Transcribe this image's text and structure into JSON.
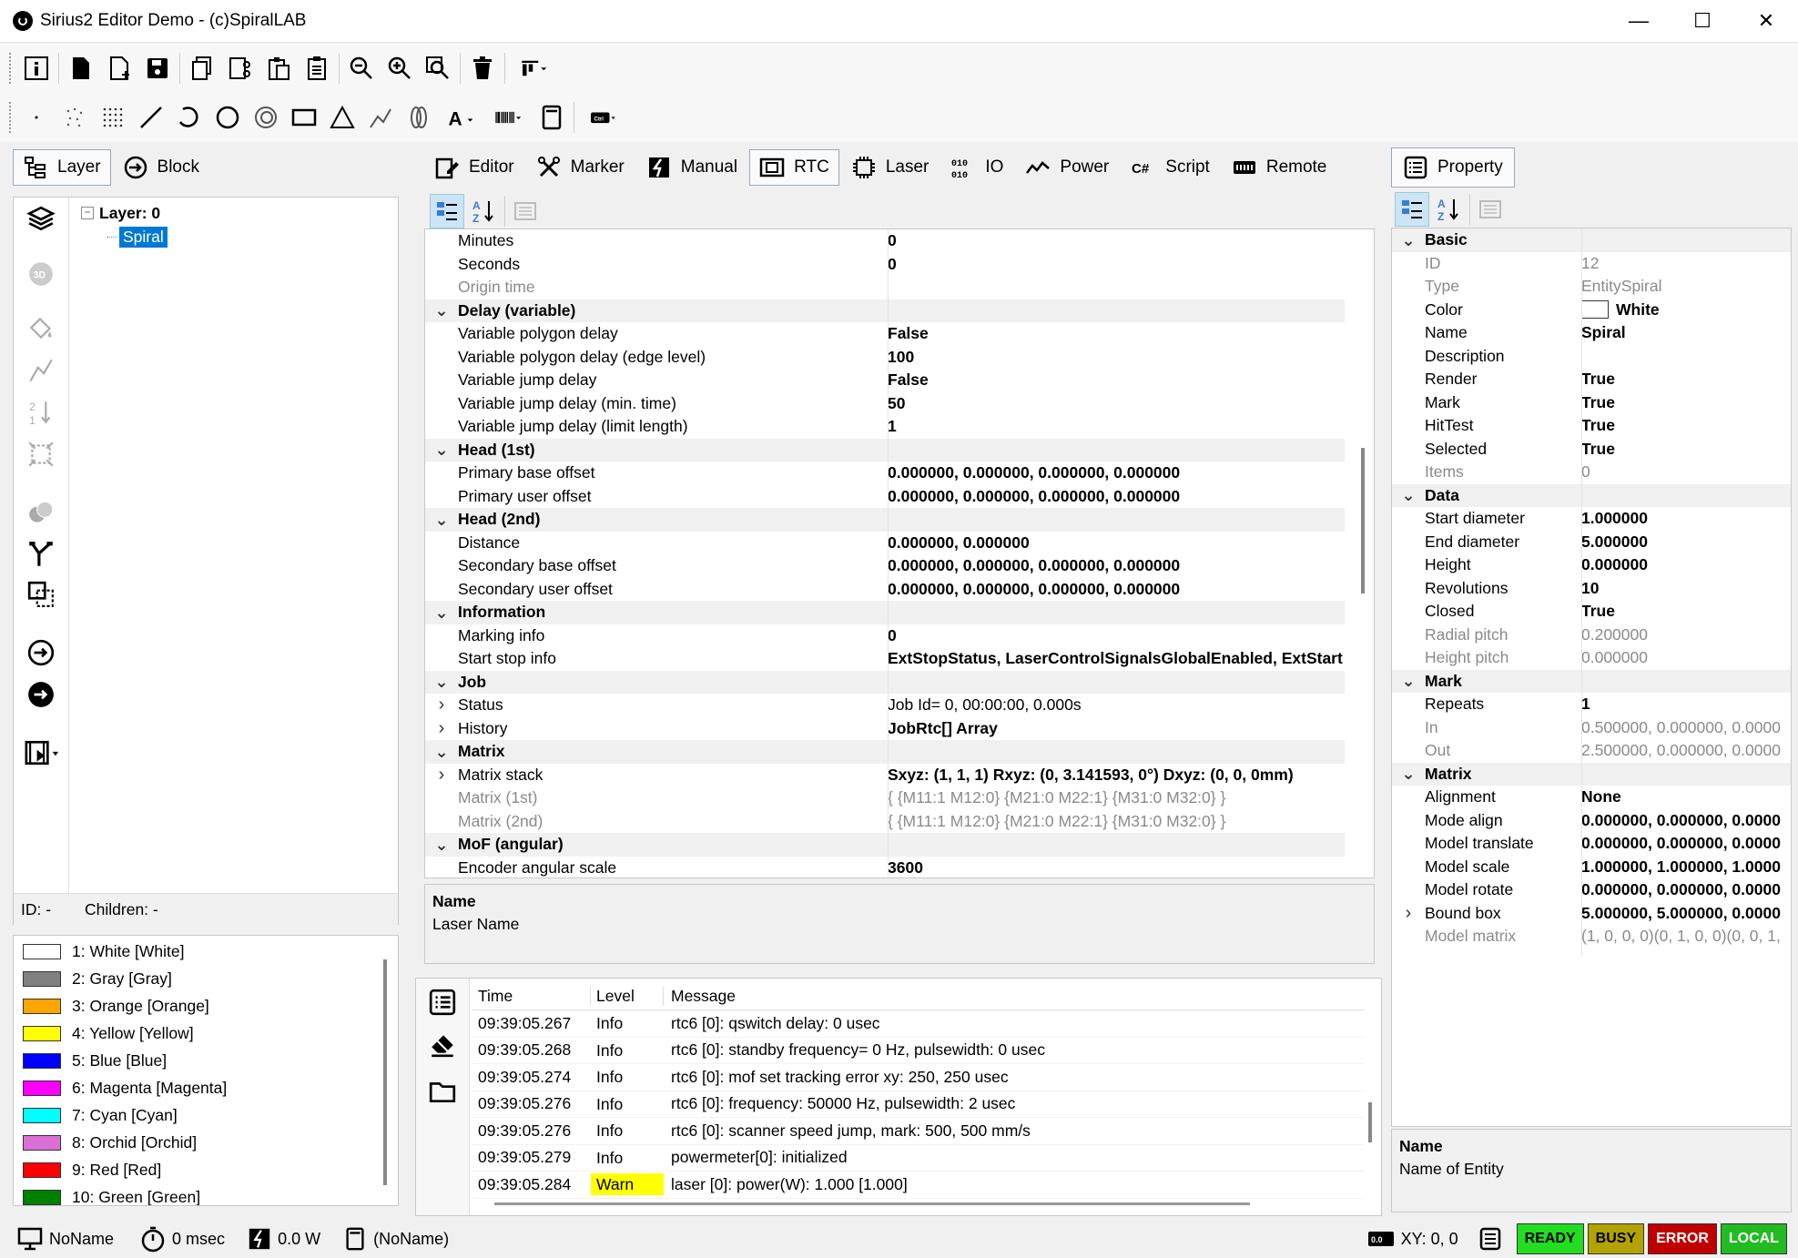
{
  "window": {
    "title": "Sirius2 Editor Demo - (c)SpiralLAB",
    "min": "—",
    "max": "☐",
    "close": "✕"
  },
  "left": {
    "tabs": {
      "layer": "Layer",
      "block": "Block"
    },
    "tree": {
      "layer": "Layer: 0",
      "child": "Spiral"
    },
    "status": {
      "id": "ID: -",
      "children": "Children: -"
    },
    "pens": [
      {
        "label": "1: White [White]",
        "color": "#ffffff"
      },
      {
        "label": "2: Gray [Gray]",
        "color": "#808080"
      },
      {
        "label": "3: Orange [Orange]",
        "color": "#ffa500"
      },
      {
        "label": "4: Yellow [Yellow]",
        "color": "#ffff00"
      },
      {
        "label": "5: Blue [Blue]",
        "color": "#0000ff"
      },
      {
        "label": "6: Magenta [Magenta]",
        "color": "#ff00ff"
      },
      {
        "label": "7: Cyan [Cyan]",
        "color": "#00ffff"
      },
      {
        "label": "8: Orchid [Orchid]",
        "color": "#da70d6"
      },
      {
        "label": "9: Red [Red]",
        "color": "#ff0000"
      },
      {
        "label": "10: Green [Green]",
        "color": "#008000"
      }
    ]
  },
  "center": {
    "tabs": [
      "Editor",
      "Marker",
      "Manual",
      "RTC",
      "Laser",
      "IO",
      "Power",
      "Script",
      "Remote"
    ],
    "grid": [
      {
        "t": "row",
        "name": "Minutes",
        "val": "0"
      },
      {
        "t": "row",
        "name": "Seconds",
        "val": "0"
      },
      {
        "t": "dis",
        "name": "Origin time",
        "val": ""
      },
      {
        "t": "cat",
        "name": "Delay (variable)"
      },
      {
        "t": "row",
        "name": "Variable polygon delay",
        "val": "False"
      },
      {
        "t": "row",
        "name": "Variable polygon delay (edge level)",
        "val": "100"
      },
      {
        "t": "row",
        "name": "Variable jump delay",
        "val": "False"
      },
      {
        "t": "row",
        "name": "Variable jump delay (min. time)",
        "val": "50"
      },
      {
        "t": "row",
        "name": "Variable jump delay (limit length)",
        "val": "1"
      },
      {
        "t": "cat",
        "name": "Head (1st)"
      },
      {
        "t": "row",
        "name": "Primary base offset",
        "val": "0.000000, 0.000000, 0.000000, 0.000000"
      },
      {
        "t": "row",
        "name": "Primary user offset",
        "val": "0.000000, 0.000000, 0.000000, 0.000000"
      },
      {
        "t": "cat",
        "name": "Head (2nd)"
      },
      {
        "t": "row",
        "name": "Distance",
        "val": "0.000000, 0.000000"
      },
      {
        "t": "row",
        "name": "Secondary base offset",
        "val": "0.000000, 0.000000, 0.000000, 0.000000"
      },
      {
        "t": "row",
        "name": "Secondary user offset",
        "val": "0.000000, 0.000000, 0.000000, 0.000000"
      },
      {
        "t": "cat",
        "name": "Information"
      },
      {
        "t": "row",
        "name": "Marking info",
        "val": "0"
      },
      {
        "t": "row",
        "name": "Start stop info",
        "val": "ExtStopStatus, LaserControlSignalsGlobalEnabled, ExtStart"
      },
      {
        "t": "cat",
        "name": "Job"
      },
      {
        "t": "sub",
        "name": "Status",
        "val": "Job Id= 0, 00:00:00, 0.000s",
        "norm": true
      },
      {
        "t": "sub",
        "name": "History",
        "val": "JobRtc[] Array"
      },
      {
        "t": "cat",
        "name": "Matrix"
      },
      {
        "t": "sub",
        "name": "Matrix stack",
        "val": "Sxyz: (1, 1, 1) Rxyz: (0, 3.141593, 0°) Dxyz: (0, 0, 0mm)"
      },
      {
        "t": "dis",
        "name": "Matrix (1st)",
        "val": "{ {M11:1 M12:0} {M21:0 M22:1} {M31:0 M32:0} }"
      },
      {
        "t": "dis",
        "name": "Matrix (2nd)",
        "val": "{ {M11:1 M12:0} {M21:0 M22:1} {M31:0 M32:0} }"
      },
      {
        "t": "cat",
        "name": "MoF (angular)"
      },
      {
        "t": "row",
        "name": "Encoder angular scale",
        "val": "3600"
      }
    ],
    "desc": {
      "title": "Name",
      "text": "Laser Name"
    },
    "log": {
      "headers": {
        "time": "Time",
        "level": "Level",
        "message": "Message"
      },
      "rows": [
        {
          "time": "09:39:05.267",
          "level": "Info",
          "msg": "rtc6 [0]: qswitch delay: 0 usec"
        },
        {
          "time": "09:39:05.268",
          "level": "Info",
          "msg": "rtc6 [0]: standby frequency= 0 Hz, pulsewidth: 0 usec"
        },
        {
          "time": "09:39:05.274",
          "level": "Info",
          "msg": "rtc6 [0]: mof set tracking error xy: 250, 250 usec"
        },
        {
          "time": "09:39:05.276",
          "level": "Info",
          "msg": "rtc6 [0]: frequency: 50000 Hz, pulsewidth: 2 usec"
        },
        {
          "time": "09:39:05.276",
          "level": "Info",
          "msg": "rtc6 [0]: scanner speed jump, mark: 500, 500 mm/s"
        },
        {
          "time": "09:39:05.279",
          "level": "Info",
          "msg": "powermeter[0]: initialized"
        },
        {
          "time": "09:39:05.284",
          "level": "Warn",
          "msg": "laser [0]: power(W): 1.000 [1.000]"
        }
      ]
    }
  },
  "right": {
    "tab": "Property",
    "grid": [
      {
        "t": "cat",
        "name": "Basic"
      },
      {
        "t": "dis",
        "name": "ID",
        "val": "12"
      },
      {
        "t": "dis",
        "name": "Type",
        "val": "EntitySpiral"
      },
      {
        "t": "color",
        "name": "Color",
        "val": "White"
      },
      {
        "t": "row",
        "name": "Name",
        "val": "Spiral"
      },
      {
        "t": "row",
        "name": "Description",
        "val": ""
      },
      {
        "t": "row",
        "name": "Render",
        "val": "True"
      },
      {
        "t": "row",
        "name": "Mark",
        "val": "True"
      },
      {
        "t": "row",
        "name": "HitTest",
        "val": "True"
      },
      {
        "t": "row",
        "name": "Selected",
        "val": "True"
      },
      {
        "t": "dis",
        "name": "Items",
        "val": "0"
      },
      {
        "t": "cat",
        "name": "Data"
      },
      {
        "t": "row",
        "name": "Start diameter",
        "val": "1.000000"
      },
      {
        "t": "row",
        "name": "End diameter",
        "val": "5.000000"
      },
      {
        "t": "row",
        "name": "Height",
        "val": "0.000000"
      },
      {
        "t": "row",
        "name": "Revolutions",
        "val": "10"
      },
      {
        "t": "row",
        "name": "Closed",
        "val": "True"
      },
      {
        "t": "dis",
        "name": "Radial pitch",
        "val": "0.200000"
      },
      {
        "t": "dis",
        "name": "Height pitch",
        "val": "0.000000"
      },
      {
        "t": "cat",
        "name": "Mark"
      },
      {
        "t": "row",
        "name": "Repeats",
        "val": "1"
      },
      {
        "t": "dis",
        "name": "In",
        "val": "0.500000, 0.000000, 0.0000"
      },
      {
        "t": "dis",
        "name": "Out",
        "val": "2.500000, 0.000000, 0.0000"
      },
      {
        "t": "cat",
        "name": "Matrix"
      },
      {
        "t": "row",
        "name": "Alignment",
        "val": "None"
      },
      {
        "t": "row",
        "name": "Mode align",
        "val": "0.000000, 0.000000, 0.0000"
      },
      {
        "t": "row",
        "name": "Model translate",
        "val": "0.000000, 0.000000, 0.0000"
      },
      {
        "t": "row",
        "name": "Model scale",
        "val": "1.000000, 1.000000, 1.0000"
      },
      {
        "t": "row",
        "name": "Model rotate",
        "val": "0.000000, 0.000000, 0.0000"
      },
      {
        "t": "sub",
        "name": "Bound box",
        "val": "5.000000, 5.000000, 0.0000"
      },
      {
        "t": "dis",
        "name": "Model matrix",
        "val": "(1, 0, 0, 0)(0, 1, 0, 0)(0, 0, 1,"
      }
    ],
    "desc": {
      "title": "Name",
      "text": "Name of Entity"
    }
  },
  "status": {
    "name": "NoName",
    "time": "0 msec",
    "power": "0.0 W",
    "doc": "(NoName)",
    "xy": "XY: 0, 0",
    "ready": "READY",
    "busy": "BUSY",
    "error": "ERROR",
    "local": "LOCAL"
  },
  "colors": {
    "selection": "#0078d7",
    "warn": "#ffff00",
    "ready": "#22dd22",
    "busy": "#b3a300",
    "error": "#c00000",
    "local": "#22bb22"
  }
}
